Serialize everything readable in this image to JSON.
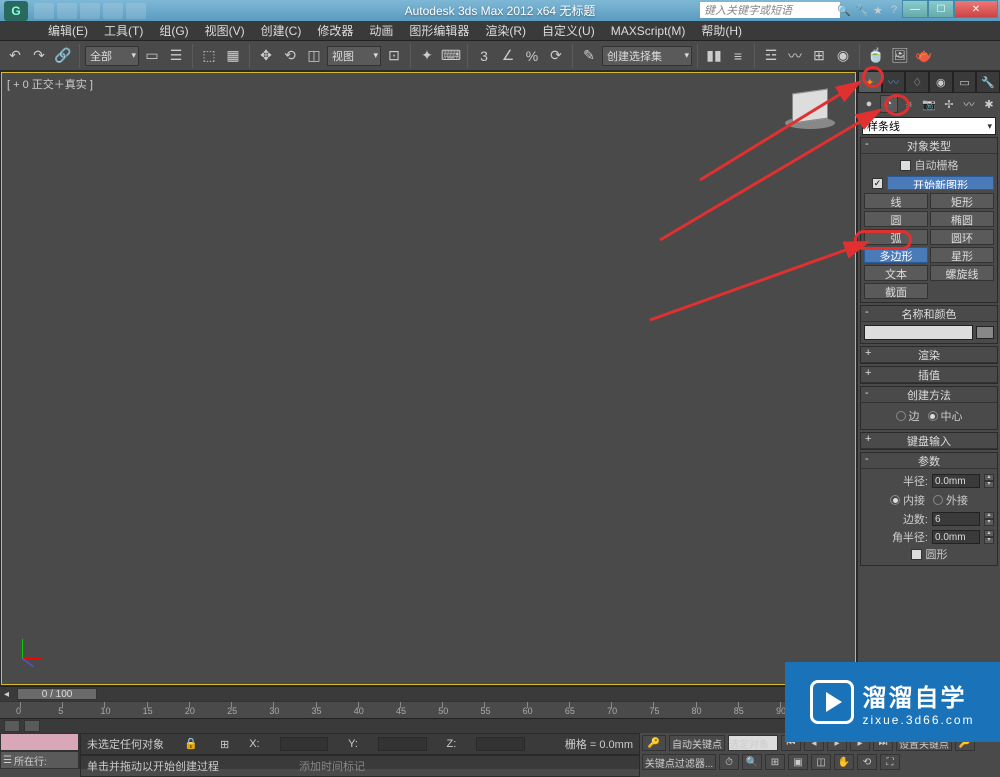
{
  "title": "Autodesk 3ds Max 2012 x64   无标题",
  "search_placeholder": "键入关键字或短语",
  "menus": [
    "编辑(E)",
    "工具(T)",
    "组(G)",
    "视图(V)",
    "创建(C)",
    "修改器",
    "动画",
    "图形编辑器",
    "渲染(R)",
    "自定义(U)",
    "MAXScript(M)",
    "帮助(H)"
  ],
  "toolbar": {
    "all": "全部",
    "view": "视图",
    "selset": "创建选择集"
  },
  "viewport": {
    "label": "[ + 0 正交＋真实 ]"
  },
  "panel": {
    "spline_dropdown": "样条线",
    "rollouts": {
      "object_type": "对象类型",
      "autogrid": "自动栅格",
      "start_new": "开始新图形",
      "name_color": "名称和颜色",
      "render": "渲染",
      "interp": "插值",
      "create_method": "创建方法",
      "keyboard": "键盘输入",
      "params": "参数"
    },
    "buttons": {
      "line": "线",
      "rect": "矩形",
      "circle": "圆",
      "ellipse": "椭圆",
      "arc": "弧",
      "donut": "圆环",
      "ngon": "多边形",
      "star": "星形",
      "text": "文本",
      "helix": "螺旋线",
      "section": "截面"
    },
    "create_method_opts": {
      "edge": "边",
      "center": "中心"
    },
    "params_labels": {
      "radius": "半径:",
      "inscribe": "内接",
      "circum": "外接",
      "sides": "边数:",
      "corner": "角半径:",
      "circular": "圆形"
    },
    "params_values": {
      "radius": "0.0mm",
      "sides": "6",
      "corner": "0.0mm"
    }
  },
  "timeline": {
    "slider": "0 / 100",
    "marks": [
      0,
      5,
      10,
      15,
      20,
      25,
      30,
      35,
      40,
      45,
      50,
      55,
      60,
      65,
      70,
      75,
      80,
      85,
      90
    ]
  },
  "status": {
    "none_selected": "未选定任何对象",
    "prompt": "单击并拖动以开始创建过程",
    "floor": "所在行:",
    "add_marker": "添加时间标记",
    "x": "X:",
    "y": "Y:",
    "z": "Z:",
    "grid": "栅格 = 0.0mm",
    "autokey": "自动关键点",
    "selkey": "选定对象",
    "setkey": "设置关键点",
    "keyfilter": "关键点过滤器..."
  },
  "watermark": {
    "big": "溜溜自学",
    "small": "zixue.3d66.com"
  }
}
